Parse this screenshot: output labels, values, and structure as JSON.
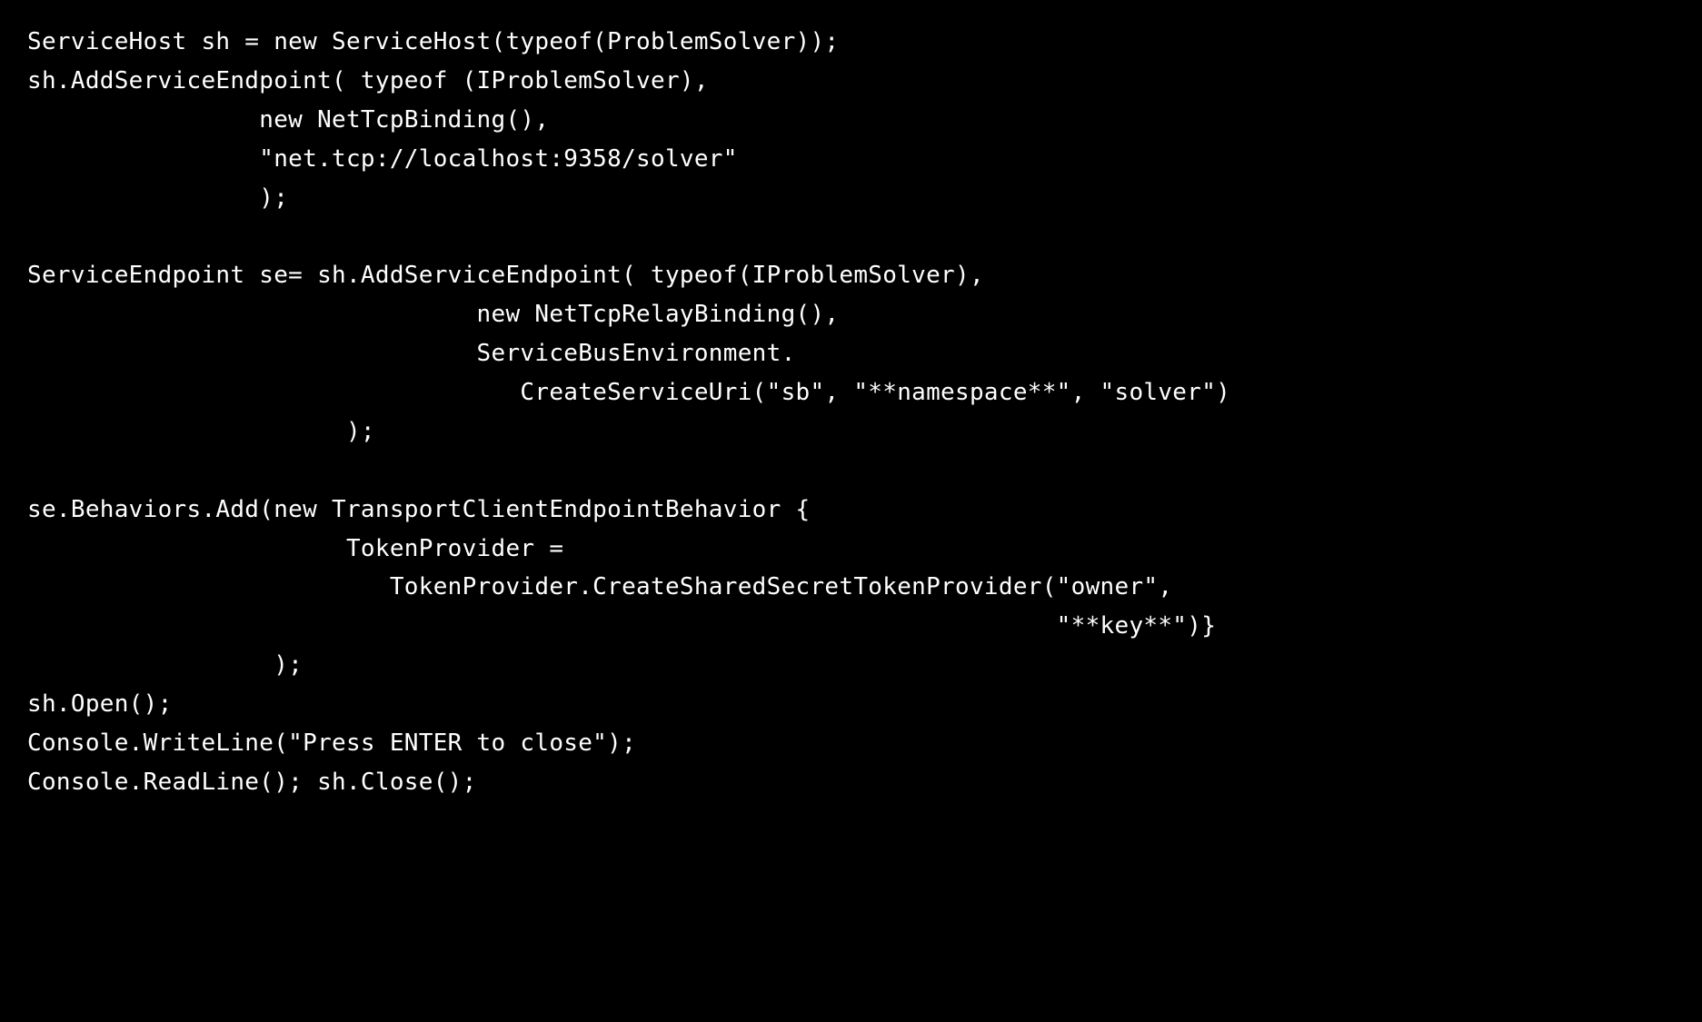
{
  "code": {
    "l01": "ServiceHost sh = new ServiceHost(typeof(ProblemSolver));",
    "l02": "sh.AddServiceEndpoint( typeof (IProblemSolver),",
    "l03": "                new NetTcpBinding(),",
    "l04": "                \"net.tcp://localhost:9358/solver\"",
    "l05": "                );",
    "l06": "",
    "l07": "ServiceEndpoint se= sh.AddServiceEndpoint( typeof(IProblemSolver),",
    "l08": "                               new NetTcpRelayBinding(),",
    "l09": "                               ServiceBusEnvironment.",
    "l10": "                                  CreateServiceUri(\"sb\", \"**namespace**\", \"solver\")",
    "l11": "                      );",
    "l12": "",
    "l13": "se.Behaviors.Add(new TransportClientEndpointBehavior {",
    "l14": "                      TokenProvider =",
    "l15": "                         TokenProvider.CreateSharedSecretTokenProvider(\"owner\",",
    "l16": "                                                                       \"**key**\")}",
    "l17": "                 );",
    "l18": "sh.Open();",
    "l19": "Console.WriteLine(\"Press ENTER to close\");",
    "l20": "Console.ReadLine(); sh.Close();"
  }
}
